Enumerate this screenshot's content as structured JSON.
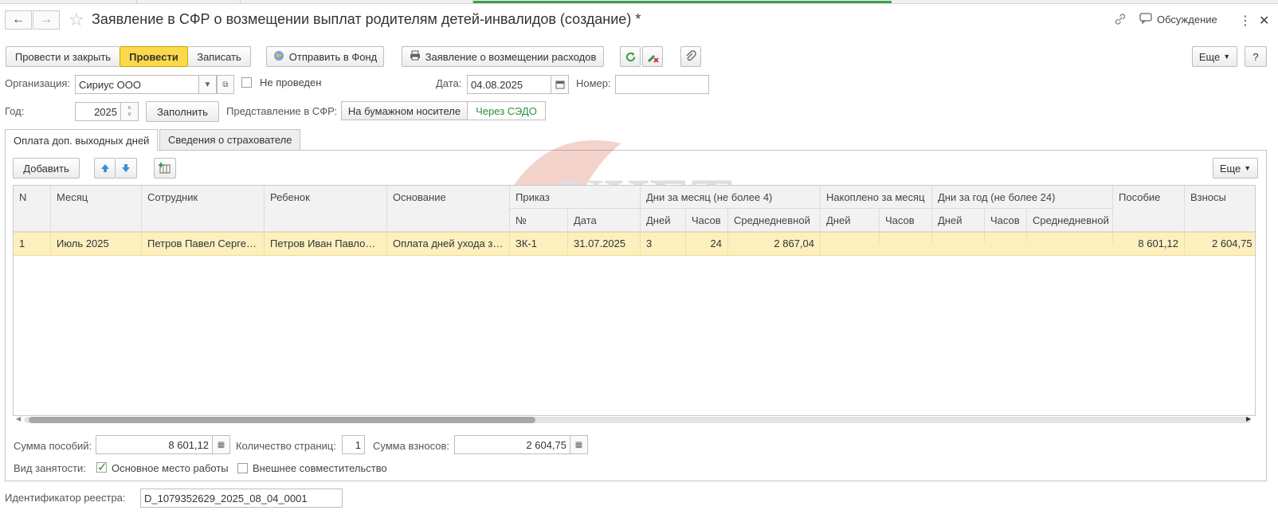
{
  "window": {
    "title": "Заявление в СФР о возмещении выплат родителям детей-инвалидов (создание) *",
    "discuss_label": "Обсуждение"
  },
  "toolbar": {
    "post_close_label": "Провести и закрыть",
    "post_label": "Провести",
    "save_label": "Записать",
    "send_label": "Отправить в Фонд",
    "print_label": "Заявление о возмещении расходов",
    "more_label": "Еще",
    "help_label": "?"
  },
  "form": {
    "org_label": "Организация:",
    "org_value": "Сириус ООО",
    "not_posted_label": "Не проведен",
    "date_label": "Дата:",
    "date_value": "04.08.2025",
    "number_label": "Номер:",
    "number_value": "",
    "year_label": "Год:",
    "year_value": "2025",
    "fill_label": "Заполнить",
    "presentation_label": "Представление в СФР:",
    "paper_label": "На бумажном носителе",
    "sedo_label": "Через СЭДО"
  },
  "tabs": {
    "tab1": "Оплата доп. выходных дней",
    "tab2": "Сведения о страхователе"
  },
  "table_toolbar": {
    "add_label": "Добавить",
    "more_label": "Еще"
  },
  "table": {
    "headers": {
      "n": "N",
      "month": "Месяц",
      "employee": "Сотрудник",
      "child": "Ребенок",
      "basis": "Основание",
      "order": "Приказ",
      "order_no": "№",
      "order_date": "Дата",
      "days_month": "Дни за месяц (не более 4)",
      "dm_days": "Дней",
      "dm_hours": "Часов",
      "dm_avg": "Среднедневной",
      "accum": "Накоплено за месяц",
      "ac_days": "Дней",
      "ac_hours": "Часов",
      "days_year": "Дни за год (не более 24)",
      "dy_days": "Дней",
      "dy_hours": "Часов",
      "dy_avg": "Среднедневной",
      "benefit": "Пособие",
      "contrib": "Взносы"
    },
    "rows": [
      {
        "n": "1",
        "month": "Июль 2025",
        "employee": "Петров Павел Сергеевич",
        "child": "Петров Иван Павлович",
        "basis": "Оплата дней ухода за ребенком-инвалидом",
        "order_no": "ЗК-1",
        "order_date": "31.07.2025",
        "dm_days": "3",
        "dm_hours": "24",
        "dm_avg": "2 867,04",
        "ac_days": "",
        "ac_hours": "",
        "dy_days": "",
        "dy_hours": "",
        "dy_avg": "",
        "benefit": "8 601,12",
        "contrib": "2 604,75"
      }
    ]
  },
  "totals": {
    "benefit_sum_label": "Сумма пособий:",
    "benefit_sum_value": "8 601,12",
    "pages_label": "Количество страниц:",
    "pages_value": "1",
    "contrib_sum_label": "Сумма взносов:",
    "contrib_sum_value": "2 604,75",
    "employment_label": "Вид занятости:",
    "main_job_label": "Основное место работы",
    "external_label": "Внешнее совместительство"
  },
  "registry": {
    "label": "Идентификатор реестра:",
    "value": "D_1079352629_2025_08_04_0001"
  },
  "watermark": {
    "line1": "УЧЕТ",
    "line2": "БЕЗ ЗАБОТ"
  }
}
